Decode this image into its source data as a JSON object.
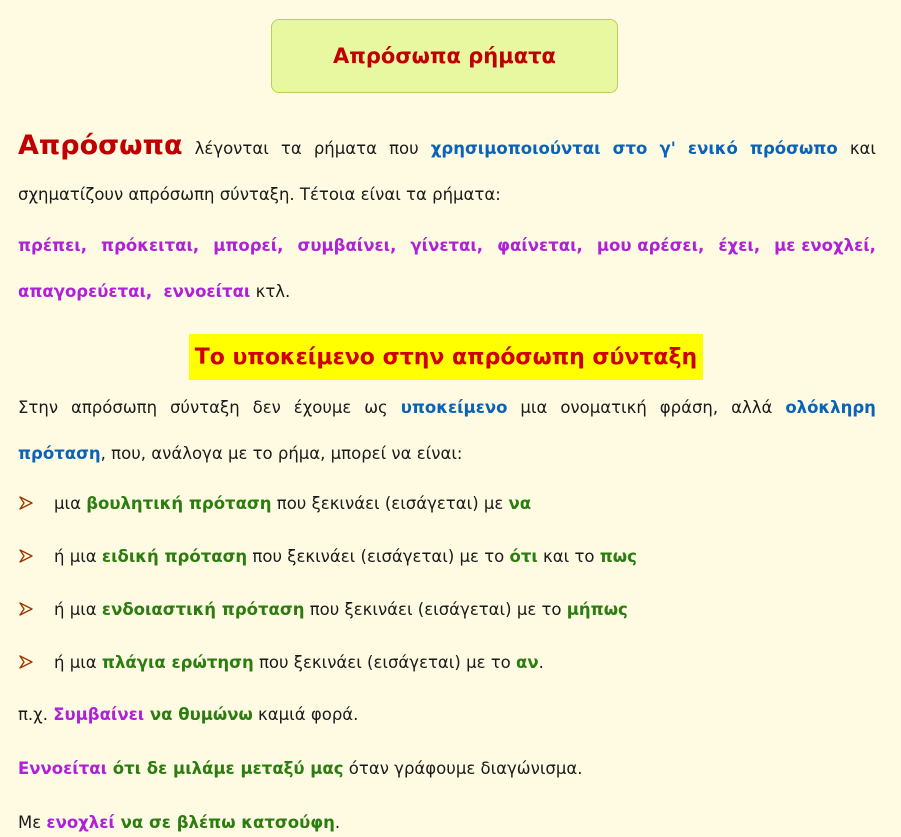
{
  "title": "Απρόσωπα ρήματα",
  "intro": {
    "term": "Απρόσωπα",
    "w1": "λέγονται",
    "w2": "τα",
    "w3": "ρήματα",
    "w4": "που",
    "h1": "χρησιμοποιούνται",
    "h2": "στο",
    "h3": "γ'",
    "h4": "ενικό",
    "h5": "πρόσωπο",
    "w5": "και",
    "line2": "σχηματίζουν απρόσωπη σύνταξη. Τέτοια είναι τα ρήματα:"
  },
  "verbs_line1": [
    "πρέπει,",
    "πρόκειται,",
    "μπορεί,",
    "συμβαίνει,",
    "γίνεται,",
    "φαίνεται,",
    "μου αρέσει,",
    "έχει,",
    "με ενοχλεί,"
  ],
  "verbs_line2_a": "απαγορεύεται,",
  "verbs_line2_b": "εννοείται",
  "verbs_line2_c": " κτλ.",
  "subtitle": "Το υποκείμενο στην απρόσωπη σύνταξη",
  "subject": {
    "l1": [
      "Στην",
      "απρόσωπη",
      "σύνταξη",
      "δεν",
      "έχουμε",
      "ως"
    ],
    "h1": "υποκείμενο",
    "l1b": [
      "μια",
      "ονοματική",
      "φράση,",
      "αλλά"
    ],
    "h2": "ολόκληρη",
    "h3": "πρόταση",
    "line2": ", που, ανάλογα με το ρήμα, μπορεί να είναι:"
  },
  "bullets": [
    {
      "pre": "μια ",
      "hl": "βουλητική πρόταση",
      "mid": " που ξεκινάει (εισάγεται) με ",
      "w1": "να",
      "mid2": "",
      "w2": "",
      "end": ""
    },
    {
      "pre": "ή μια ",
      "hl": "ειδική πρόταση",
      "mid": " που ξεκινάει (εισάγεται) με το ",
      "w1": "ότι",
      "mid2": " και το ",
      "w2": "πως",
      "end": ""
    },
    {
      "pre": "ή μια ",
      "hl": "ενδοιαστική πρόταση",
      "mid": " που ξεκινάει (εισάγεται) με το ",
      "w1": "μήπως",
      "mid2": "",
      "w2": "",
      "end": ""
    },
    {
      "pre": "ή μια ",
      "hl": "πλάγια ερώτηση",
      "mid": " που ξεκινάει (εισάγεται) με το ",
      "w1": "αν",
      "mid2": "",
      "w2": "",
      "end": "."
    }
  ],
  "examples": [
    {
      "pre": "π.χ. ",
      "m": "Συμβαίνει",
      "g": " να θυμώνω",
      "post": " καμιά φορά."
    },
    {
      "pre": "",
      "m": "Εννοείται",
      "g": " ότι δε μιλάμε μεταξύ μας",
      "post": " όταν γράφουμε διαγώνισμα."
    },
    {
      "pre": "Με ",
      "m": "ενοχλεί",
      "g": " να σε βλέπω κατσούφη",
      "post": "."
    }
  ],
  "colors": {
    "title_red": "#c00000",
    "blue": "#0a63b8",
    "magenta": "#b020d8",
    "green": "#2b7d0f",
    "yellow": "#ffff00",
    "bg": "#fffbe3"
  }
}
